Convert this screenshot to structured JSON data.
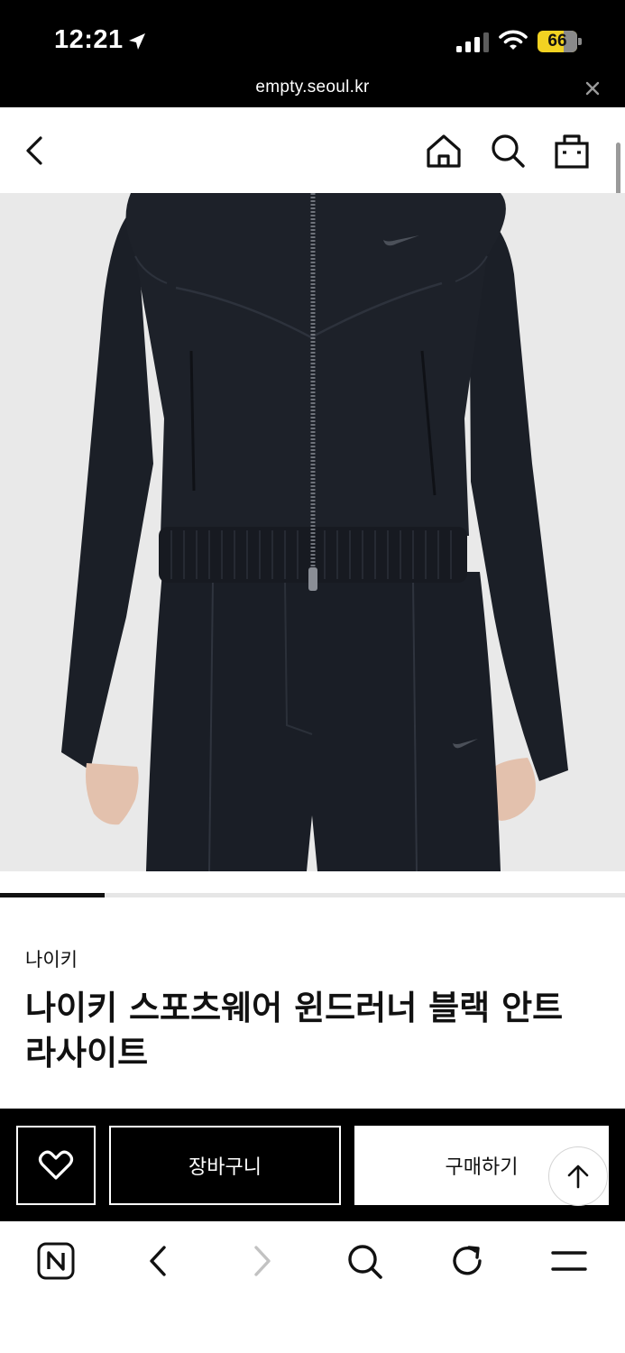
{
  "status_bar": {
    "time": "12:21",
    "battery": "66",
    "battery_level_percent": 66,
    "icons": [
      "location-arrow-icon",
      "cellular-signal-icon",
      "wifi-icon",
      "battery-charging-icon"
    ]
  },
  "browser": {
    "url": "empty.seoul.kr",
    "close_icon": "close-icon",
    "toolbar_icons": [
      "naver-n-icon",
      "back-arrow-icon",
      "forward-arrow-icon",
      "search-icon",
      "reload-icon",
      "menu-icon"
    ]
  },
  "header": {
    "icons": [
      "back-chevron-icon",
      "home-icon",
      "search-icon",
      "shopping-bag-icon"
    ]
  },
  "gallery": {
    "progress_fraction": 0.167
  },
  "product": {
    "brand": "나이키",
    "title": "나이키 스포츠웨어 윈드러너 블랙 안트라사이트"
  },
  "actions": {
    "wish_icon": "heart-outline-icon",
    "cart_label": "장바구니",
    "buy_label": "구매하기",
    "top_icon": "arrow-up-icon"
  },
  "colors": {
    "bar_background": "#000000",
    "image_background": "#e9e9e9",
    "battery": "#f2d222"
  }
}
